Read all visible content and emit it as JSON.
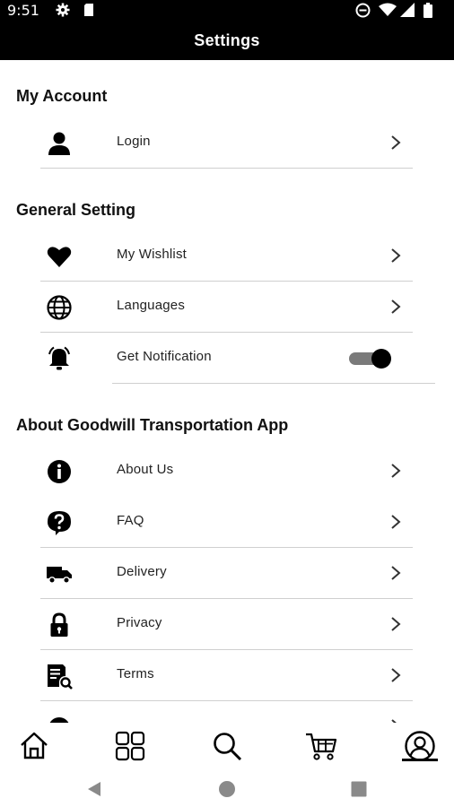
{
  "status_bar": {
    "time": "9:51"
  },
  "app_bar": {
    "title": "Settings"
  },
  "sections": {
    "account": {
      "title": "My Account"
    },
    "general": {
      "title": "General Setting"
    },
    "about": {
      "title": "About Goodwill Transportation App"
    }
  },
  "rows": {
    "login": {
      "label": "Login",
      "icon": "person-icon"
    },
    "wishlist": {
      "label": "My Wishlist",
      "icon": "heart-icon"
    },
    "languages": {
      "label": "Languages",
      "icon": "globe-icon"
    },
    "notification": {
      "label": "Get Notification",
      "icon": "bell-icon",
      "enabled": true
    },
    "about_us": {
      "label": "About Us",
      "icon": "info-icon"
    },
    "faq": {
      "label": "FAQ",
      "icon": "question-icon"
    },
    "delivery": {
      "label": "Delivery",
      "icon": "truck-icon"
    },
    "privacy": {
      "label": "Privacy",
      "icon": "lock-icon"
    },
    "terms": {
      "label": "Terms",
      "icon": "document-search-icon"
    }
  },
  "bottom_nav": {
    "items": [
      "home-icon",
      "grid-icon",
      "search-icon",
      "cart-icon",
      "profile-icon"
    ],
    "active": "profile-icon"
  },
  "colors": {
    "bar": "#000000",
    "toggle_track": "#7a7a7a",
    "toggle_thumb": "#000000"
  }
}
